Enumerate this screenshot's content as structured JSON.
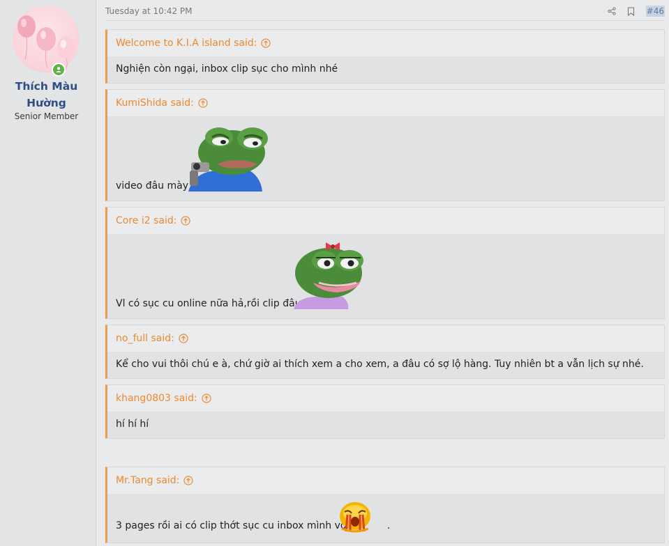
{
  "user": {
    "name": "Thích Màu Hường",
    "title": "Senior Member"
  },
  "post": {
    "date": "Tuesday at 10:42 PM",
    "number": "#46"
  },
  "icons": {
    "share": "share-icon",
    "bookmark": "bookmark-icon",
    "online": "online-status-icon",
    "jump": "arrow-up-circle-icon"
  },
  "colors": {
    "accent": "#f39a4a",
    "username": "#2d4e86",
    "online": "#63b34a"
  },
  "quotes": [
    {
      "author": "Welcome to K.I.A island said:",
      "text": "Nghiện còn ngại, inbox clip sục cho mình nhé"
    },
    {
      "author": "KumiShida said:",
      "text": "video đâu mày"
    },
    {
      "author": "Core i2 said:",
      "text": "Vl có sục cu online nữa hả,rồi clip đâu"
    },
    {
      "author": "no_full said:",
      "text": "Kể cho vui thôi chú e à, chứ giờ ai thích xem a cho xem, a đâu có sợ lộ hàng. Tuy nhiên bt a vẫn lịch sự nhé."
    },
    {
      "author": "khang0803 said:",
      "text": "hí hí hí"
    },
    {
      "author": "Mr.Tang said:",
      "text": "3 pages rồi ai có clip thớt sục cu inbox mình với",
      "suffix": "."
    }
  ]
}
